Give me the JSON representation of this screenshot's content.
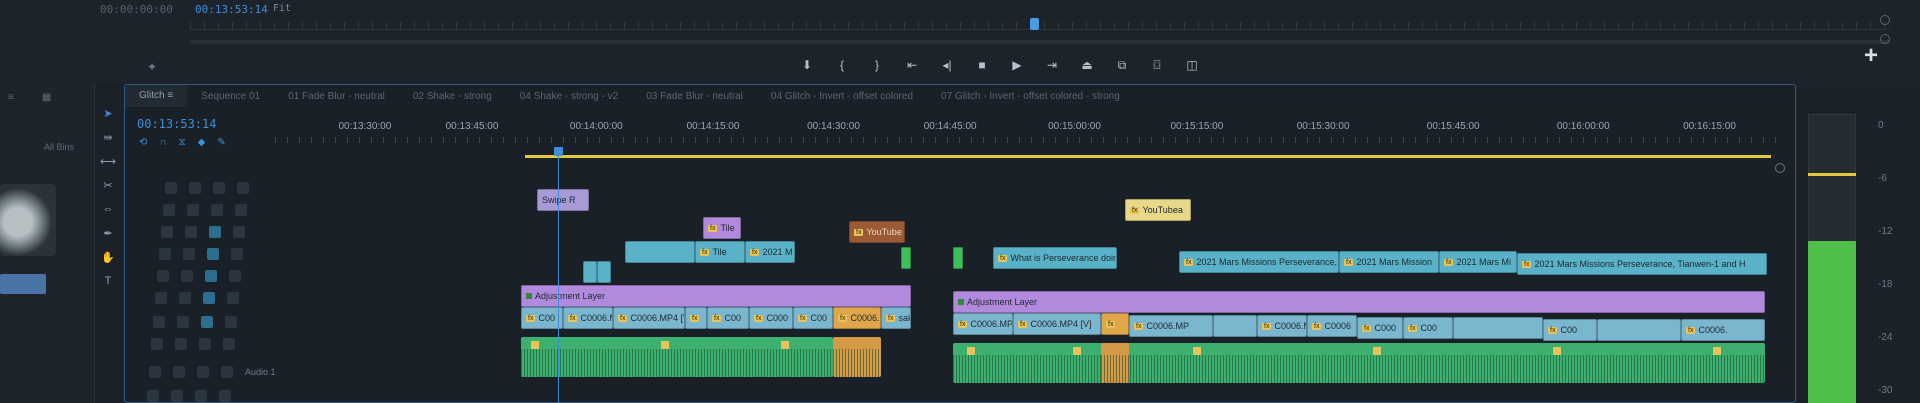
{
  "monitor": {
    "timecode_in": "00:00:00:00",
    "timecode_current": "00:13:53:14",
    "fit_label": "Fit",
    "settings_icon": "wrench-icon",
    "transport": [
      {
        "name": "add-marker-icon",
        "glyph": "⬇"
      },
      {
        "name": "mark-in-icon",
        "glyph": "{"
      },
      {
        "name": "mark-out-icon",
        "glyph": "}"
      },
      {
        "name": "go-to-in-icon",
        "glyph": "⇤"
      },
      {
        "name": "step-back-icon",
        "glyph": "◂|"
      },
      {
        "name": "stop-icon",
        "glyph": "■"
      },
      {
        "name": "play-icon",
        "glyph": "▶"
      },
      {
        "name": "go-to-out-icon",
        "glyph": "⇥"
      },
      {
        "name": "lift-icon",
        "glyph": "⏏"
      },
      {
        "name": "extract-icon",
        "glyph": "⧉"
      },
      {
        "name": "export-frame-icon",
        "glyph": "⌼"
      },
      {
        "name": "compare-icon",
        "glyph": "◫"
      }
    ],
    "add_button": "+"
  },
  "project": {
    "zoom_label": "All Bins"
  },
  "tools": [
    "selection-tool-icon",
    "track-select-icon",
    "ripple-edit-icon",
    "razor-icon",
    "slip-icon",
    "pen-icon",
    "hand-icon",
    "type-tool-icon"
  ],
  "timeline": {
    "tabs": [
      {
        "label": "Glitch ≡",
        "active": true
      },
      {
        "label": "Sequence 01",
        "active": false
      },
      {
        "label": "01 Fade Blur - neutral",
        "active": false
      },
      {
        "label": "02 Shake - strong",
        "active": false
      },
      {
        "label": "04 Shake - strong - v2",
        "active": false
      },
      {
        "label": "03 Fade Blur - neutral",
        "active": false
      },
      {
        "label": "04 Glitch - Invert - offset colored",
        "active": false
      },
      {
        "label": "07 Glitch - Invert - offset colored - strong",
        "active": false
      }
    ],
    "playhead_timecode": "00:13:53:14",
    "ruler": [
      {
        "label": "00:13:30:00",
        "pos": 0.047
      },
      {
        "label": "00:13:45:00",
        "pos": 0.103
      },
      {
        "label": "00:14:00:00",
        "pos": 0.168
      },
      {
        "label": "00:14:15:00",
        "pos": 0.229
      },
      {
        "label": "00:14:30:00",
        "pos": 0.292
      },
      {
        "label": "00:14:45:00",
        "pos": 0.353
      },
      {
        "label": "00:15:00:00",
        "pos": 0.418
      },
      {
        "label": "00:15:15:00",
        "pos": 0.482
      },
      {
        "label": "00:15:30:00",
        "pos": 0.548
      },
      {
        "label": "00:15:45:00",
        "pos": 0.616
      },
      {
        "label": "00:16:00:00",
        "pos": 0.684
      },
      {
        "label": "00:16:15:00",
        "pos": 0.75
      }
    ],
    "track_audio_label": "Audio 1",
    "clips": {
      "title_1": "Swipe R",
      "title_2": "Tile",
      "nested_1": "Tile",
      "nested_2": "2021 M",
      "youtube_brown": "YouTube",
      "youtube_yellow": "YouTubea",
      "perseverance": "What is Perseverance doing o",
      "mars_1": "2021 Mars Missions Perseverance, Ti",
      "mars_2": "2021 Mars Mission",
      "mars_3": "2021 Mars Mi",
      "mars_4": "2021 Mars Missions Perseverance, Tianwen-1 and H",
      "adjustment_1": "Adjustment Layer",
      "adjustment_2": "Adjustment Layer",
      "v1_a": "C00",
      "v1_b": "C0006.M",
      "v1_c": "C0006.MP4 [V]",
      "v1_d": "C00",
      "v1_e": "C000",
      "v1_f": "C00",
      "v1_g": "C0006.",
      "v1_h": "sak",
      "v1_i": "C0006.MP",
      "v1_j": "C0006.MP4 [V]",
      "v1_k": "C0006.MP",
      "v1_l": "C0006.M",
      "v1_m": "C0006",
      "v1_n": "C000",
      "v1_o": "C00",
      "v1_p": "C00",
      "v1_q": "C0006."
    }
  },
  "meters": {
    "scale": [
      "0",
      "-6",
      "-12",
      "-18",
      "-24",
      "-30"
    ],
    "peak_level_db": -6,
    "level_fraction": 0.56
  }
}
